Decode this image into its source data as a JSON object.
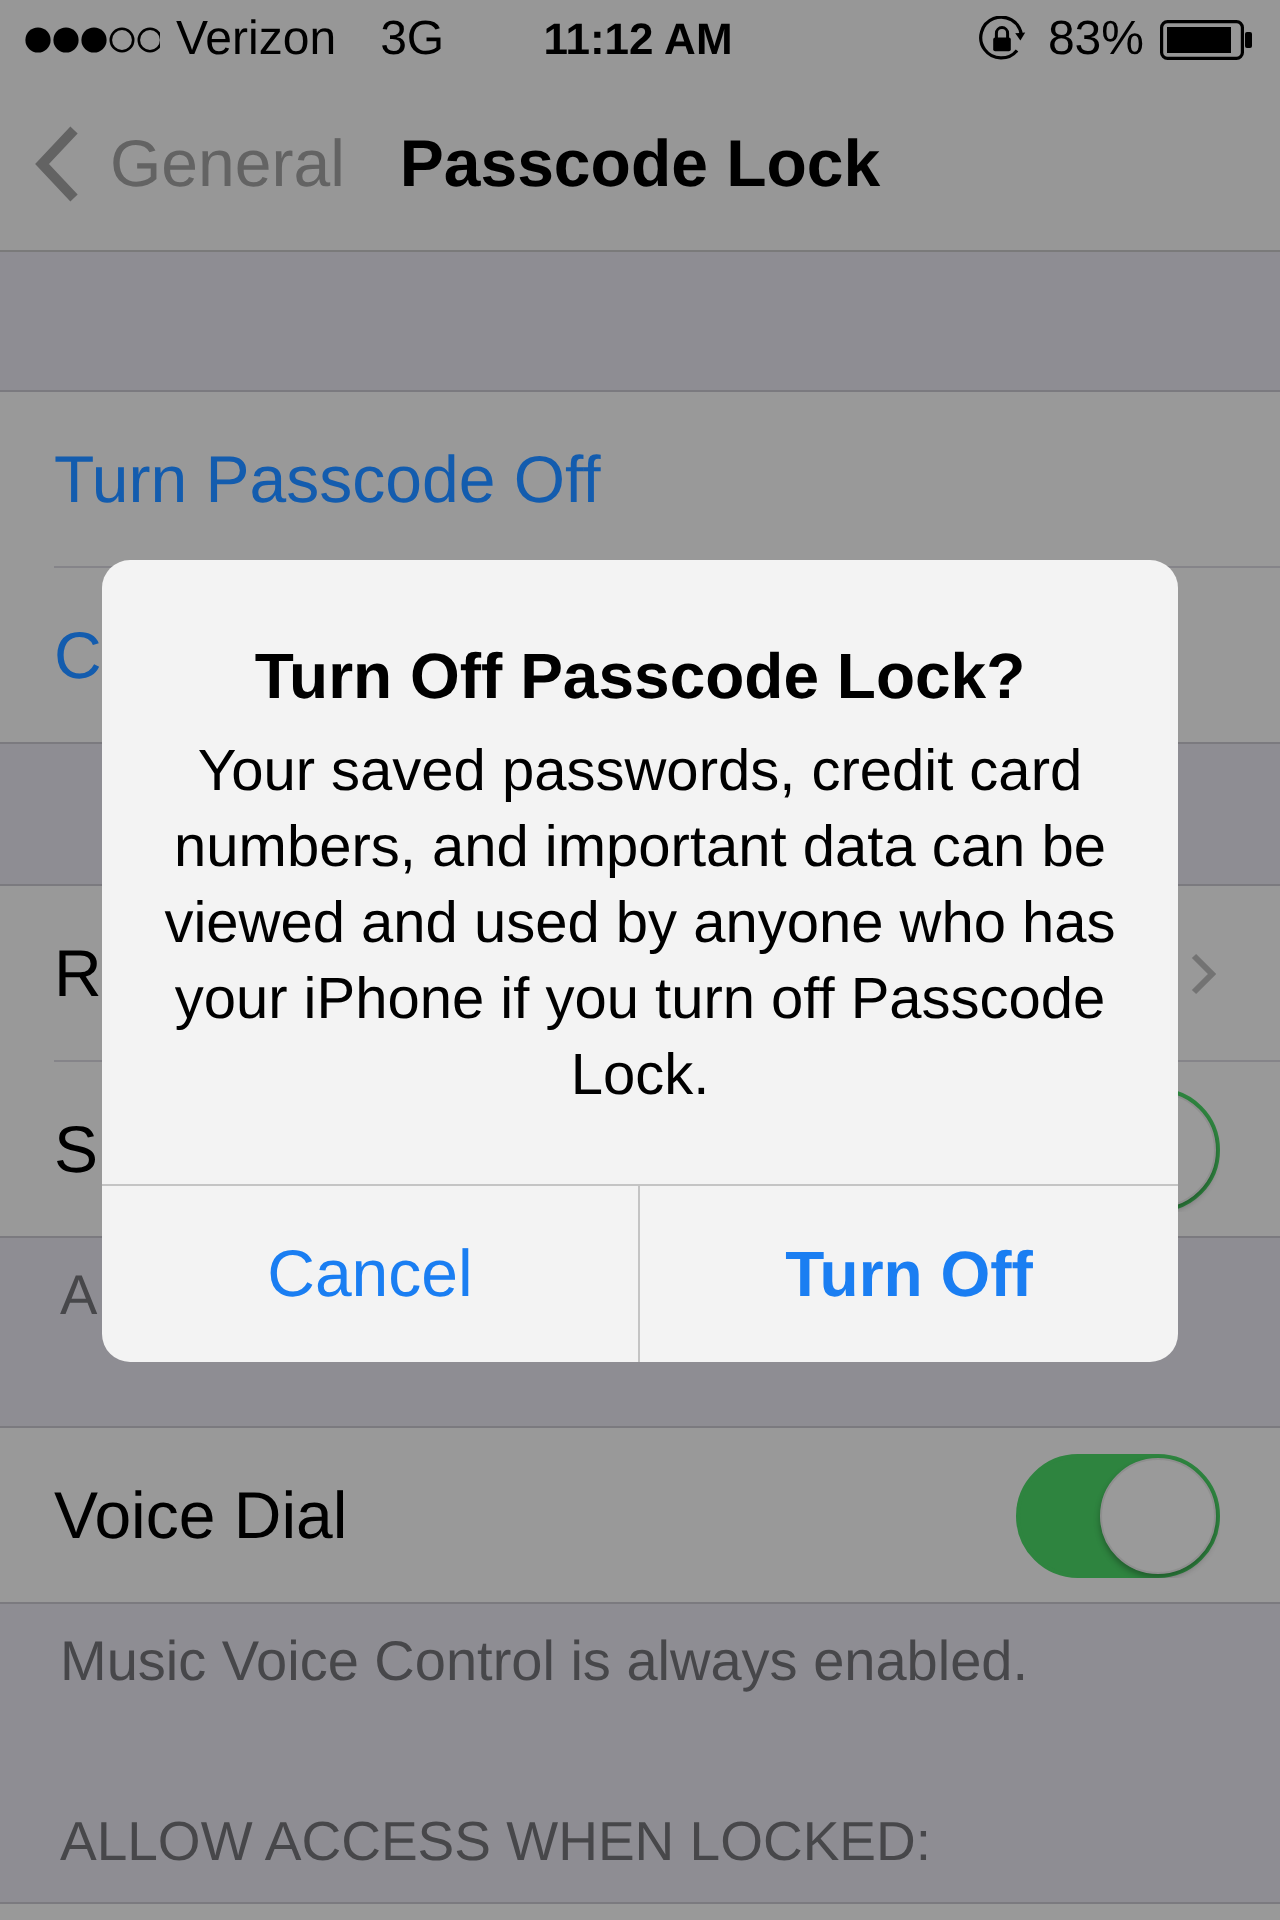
{
  "status_bar": {
    "carrier": "Verizon",
    "network": "3G",
    "time": "11:12 AM",
    "battery": "83%"
  },
  "nav_bar": {
    "back": "General",
    "title": "Passcode Lock"
  },
  "sections": [
    {
      "rows": [
        {
          "kind": "action",
          "label": "Turn Passcode Off"
        },
        {
          "kind": "action",
          "label": "C"
        }
      ]
    },
    {
      "rows": [
        {
          "kind": "disclosure",
          "label": "R"
        },
        {
          "kind": "toggle",
          "label": "S",
          "on": true,
          "covered": true
        }
      ],
      "footer": "A"
    },
    {
      "rows": [
        {
          "kind": "toggle",
          "label": "Voice Dial",
          "on": true
        }
      ],
      "footer": "Music Voice Control is always enabled."
    },
    {
      "header": "ALLOW ACCESS WHEN LOCKED:"
    }
  ],
  "alert": {
    "title": "Turn Off Passcode Lock?",
    "message": "Your saved passwords, credit card numbers, and important data can be viewed and used by anyone who has your iPhone if you turn off Passcode Lock.",
    "buttons": [
      {
        "label": "Cancel",
        "preferred": false
      },
      {
        "label": "Turn Off",
        "preferred": true
      }
    ]
  }
}
